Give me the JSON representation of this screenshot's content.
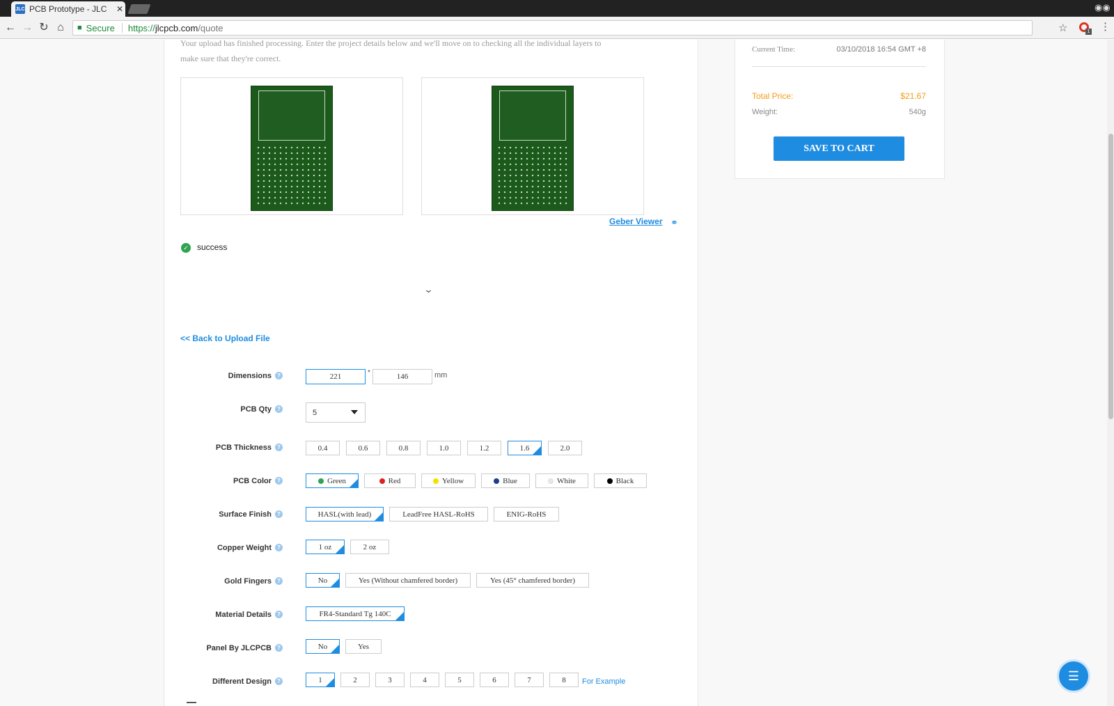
{
  "browser": {
    "tab_title": "PCB Prototype - JLC",
    "favicon": "JLC",
    "close": "✕",
    "secure": "Secure",
    "url_protocol": "https://",
    "url_host": "jlcpcb.com",
    "url_path": "/quote",
    "ext_badge": "1"
  },
  "intro": "Your upload has finished processing. Enter the project details below and we'll move on to checking all the individual layers to make sure that they're correct.",
  "geber_viewer": "Geber Viewer",
  "status": "success",
  "back_link": "<< Back to Upload File",
  "sidebar": {
    "current_time_label": "Current Time:",
    "current_time_value": "03/10/2018 16:54 GMT +8",
    "total_price_label": "Total Price:",
    "total_price_value": "$21.67",
    "weight_label": "Weight:",
    "weight_value": "540g",
    "save_button": "SAVE TO CART"
  },
  "form": {
    "dimensions": {
      "label": "Dimensions",
      "width": "221",
      "height": "146",
      "sep": "*",
      "unit": "mm"
    },
    "qty": {
      "label": "PCB Qty",
      "value": "5"
    },
    "thickness": {
      "label": "PCB Thickness",
      "options": [
        "0.4",
        "0.6",
        "0.8",
        "1.0",
        "1.2",
        "1.6",
        "2.0"
      ],
      "selected": "1.6"
    },
    "color": {
      "label": "PCB Color",
      "options": [
        "Green",
        "Red",
        "Yellow",
        "Blue",
        "White",
        "Black"
      ],
      "dot_colors": [
        "#2ea44f",
        "#e02020",
        "#f5e000",
        "#1a3e8c",
        "#e8e8e8",
        "#000000"
      ],
      "selected": "Green"
    },
    "finish": {
      "label": "Surface Finish",
      "options": [
        "HASL(with lead)",
        "LeadFree HASL-RoHS",
        "ENIG-RoHS"
      ],
      "selected": "HASL(with lead)"
    },
    "copper": {
      "label": "Copper Weight",
      "options": [
        "1 oz",
        "2 oz"
      ],
      "selected": "1 oz"
    },
    "gold": {
      "label": "Gold Fingers",
      "options": [
        "No",
        "Yes (Without chamfered border)",
        "Yes (45° chamfered border)"
      ],
      "selected": "No"
    },
    "material": {
      "label": "Material Details",
      "options": [
        "FR4-Standard Tg 140C"
      ],
      "selected": "FR4-Standard Tg 140C"
    },
    "panel": {
      "label": "Panel By JLCPCB",
      "options": [
        "No",
        "Yes"
      ],
      "selected": "No"
    },
    "design": {
      "label": "Different Design",
      "options": [
        "1",
        "2",
        "3",
        "4",
        "5",
        "6",
        "7",
        "8"
      ],
      "selected": "1",
      "example": "For Example"
    }
  }
}
